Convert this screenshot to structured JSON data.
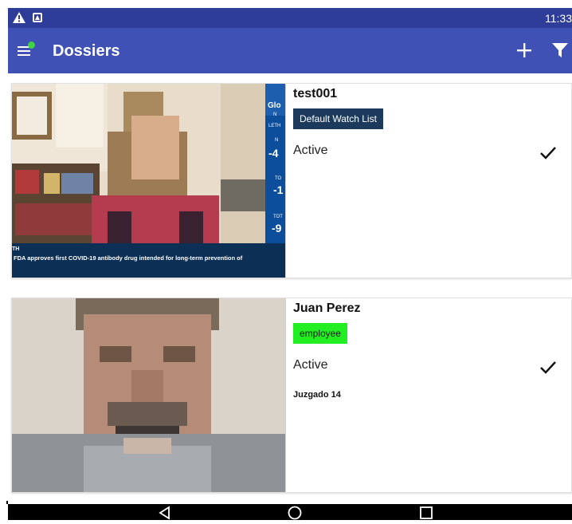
{
  "status_bar": {
    "time": "11:33",
    "icons": [
      "warning-icon",
      "notification-icon"
    ]
  },
  "app_bar": {
    "title": "Dossiers",
    "icons": [
      "menu-icon",
      "add-icon",
      "filter-icon"
    ],
    "color": "#3f51b5",
    "status_color": "#2f3d9a",
    "badge_color": "#3ed43e"
  },
  "dossiers": [
    {
      "name": "test001",
      "tag": "Default Watch List",
      "tag_color": "#1b3a5c",
      "tag_text_color": "#ffffff",
      "status": "Active",
      "note": "",
      "photo": {
        "ticker_text": "FDA approves first COVID-19 antibody drug intended for long-term prevention of",
        "side_labels": [
          "Glo",
          "N",
          "LETH",
          "N",
          "-4",
          "TO",
          "-1",
          "TOT",
          "-9"
        ],
        "corner_label": "TH"
      }
    },
    {
      "name": "Juan Perez",
      "tag": "employee",
      "tag_color": "#22ee22",
      "tag_text_color": "#1a1a1a",
      "status": "Active",
      "note": "Juzgado 14"
    }
  ],
  "nav_bar": {
    "icons": [
      "back-icon",
      "home-icon",
      "recents-icon"
    ]
  }
}
